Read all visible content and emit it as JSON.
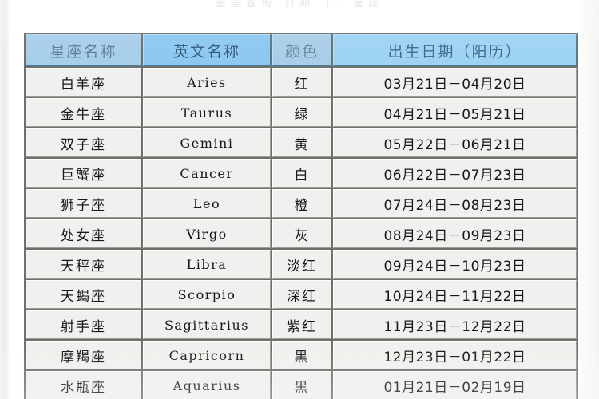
{
  "page": {
    "top_caption": "星座查询 日期 十二星座"
  },
  "table": {
    "headers": [
      {
        "label": "星座名称",
        "name": "header-zodiac-name"
      },
      {
        "label": "英文名称",
        "name": "header-english-name"
      },
      {
        "label": "颜色",
        "name": "header-color"
      },
      {
        "label": "出生日期（阳历）",
        "name": "header-birth-date"
      }
    ],
    "rows": [
      {
        "cn": "白羊座",
        "en": "Aries",
        "color": "红",
        "date": "03月21日－04月20日"
      },
      {
        "cn": "金牛座",
        "en": "Taurus",
        "color": "绿",
        "date": "04月21日－05月21日"
      },
      {
        "cn": "双子座",
        "en": "Gemini",
        "color": "黄",
        "date": "05月22日－06月21日"
      },
      {
        "cn": "巨蟹座",
        "en": "Cancer",
        "color": "白",
        "date": "06月22日－07月23日"
      },
      {
        "cn": "狮子座",
        "en": "Leo",
        "color": "橙",
        "date": "07月24日－08月23日"
      },
      {
        "cn": "处女座",
        "en": "Virgo",
        "color": "灰",
        "date": "08月24日－09月23日"
      },
      {
        "cn": "天秤座",
        "en": "Libra",
        "color": "淡红",
        "date": "09月24日－10月23日"
      },
      {
        "cn": "天蝎座",
        "en": "Scorpio",
        "color": "深红",
        "date": "10月24日－11月22日"
      },
      {
        "cn": "射手座",
        "en": "Sagittarius",
        "color": "紫红",
        "date": "11月23日－12月22日"
      },
      {
        "cn": "摩羯座",
        "en": "Capricorn",
        "color": "黑",
        "date": "12月23日－01月22日"
      },
      {
        "cn": "水瓶座",
        "en": "Aquarius",
        "color": "黑",
        "date": "01月21日－02月19日"
      }
    ]
  },
  "colors": {
    "header_blue": "#8ec8f2",
    "header_blue_alt": "#a8cfe9",
    "cell_bg": "#f0f1ee",
    "grid": "#6e706a",
    "text": "#171717"
  }
}
